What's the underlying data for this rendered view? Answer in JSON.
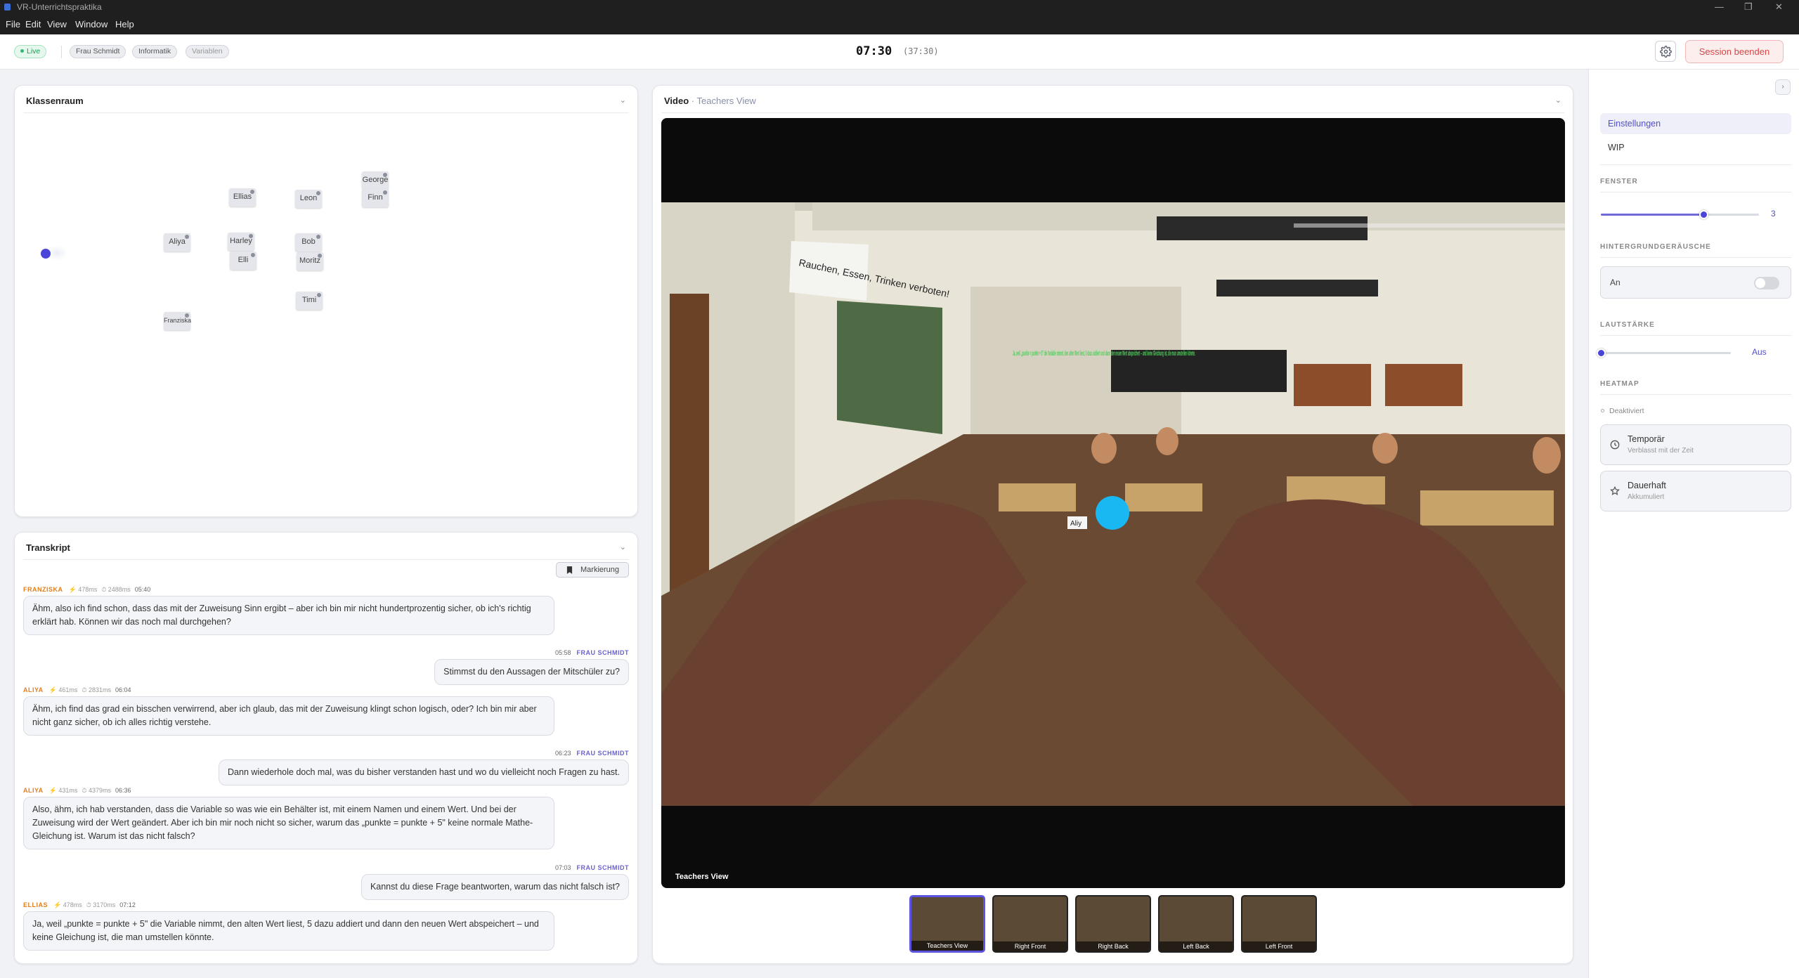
{
  "window": {
    "title": "VR-Unterrichtspraktika"
  },
  "menu": [
    "File",
    "Edit",
    "View",
    "Window",
    "Help"
  ],
  "header": {
    "live_label": "Live",
    "tags": [
      "Frau Schmidt",
      "Informatik",
      "Variablen"
    ],
    "timer": "07:30",
    "timer_total": "(37:30)",
    "end_session_label": "Session beenden"
  },
  "classroom": {
    "title": "Klassenraum",
    "students": [
      "Ellias",
      "Leon",
      "George",
      "Finn",
      "Aliya",
      "Harley",
      "Bob",
      "Elli",
      "Moritz",
      "Timi",
      "Franziska"
    ]
  },
  "transcript": {
    "title": "Transkript",
    "mark_button": "Markierung",
    "messages": [
      {
        "speaker": "FRANZISKA",
        "m1": "⚡ 478ms",
        "m2": "⏱ 2488ms",
        "time": "05:40",
        "text": "Ähm, also ich find schon, dass das mit der Zuweisung Sinn ergibt – aber ich bin mir nicht hundertprozentig sicher, ob ich's richtig erklärt hab. Können wir das noch mal durchgehen?"
      },
      {
        "speaker": "FRAU SCHMIDT",
        "time": "05:58",
        "text": "Stimmst du den Aussagen der Mitschüler zu?"
      },
      {
        "speaker": "ALIYA",
        "m1": "⚡ 461ms",
        "m2": "⏱ 2831ms",
        "time": "06:04",
        "text": "Ähm, ich find das grad ein bisschen verwirrend, aber ich glaub, das mit der Zuweisung klingt schon logisch, oder? Ich bin mir aber nicht ganz sicher, ob ich alles richtig verstehe."
      },
      {
        "speaker": "FRAU SCHMIDT",
        "time": "06:23",
        "text": "Dann wiederhole doch mal, was du bisher verstanden hast und wo du vielleicht noch Fragen zu hast."
      },
      {
        "speaker": "ALIYA",
        "m1": "⚡ 431ms",
        "m2": "⏱ 4379ms",
        "time": "06:36",
        "text": "Also, ähm, ich hab verstanden, dass die Variable so was wie ein Behälter ist, mit einem Namen und einem Wert. Und bei der Zuweisung wird der Wert geändert. Aber ich bin mir noch nicht so sicher, warum das „punkte = punkte + 5\" keine normale Mathe-Gleichung ist. Warum ist das nicht falsch?"
      },
      {
        "speaker": "FRAU SCHMIDT",
        "time": "07:03",
        "text": "Kannst du diese Frage beantworten, warum das nicht falsch ist?"
      },
      {
        "speaker": "ELLIAS",
        "m1": "⚡ 478ms",
        "m2": "⏱ 3170ms",
        "time": "07:12",
        "text": "Ja, weil „punkte = punkte + 5\" die Variable nimmt, den alten Wert liest, 5 dazu addiert und dann den neuen Wert abspeichert – und keine Gleichung ist, die man umstellen könnte."
      }
    ]
  },
  "video": {
    "title": "Video",
    "view": "Teachers View",
    "overlay_label": "Teachers View",
    "board_sign": "Rauchen, Essen, Trinken verboten!",
    "card_label": "Aliy",
    "subtitle": "Ja, weil „punkte = punkte + 5\" die Variable nimmt, den alten Wert liest, 5 dazu addiert und dann den neuen Wert abspeichert – und keine Gleichung ist, die man umstellen könnte.",
    "thumbnails": [
      "Teachers View",
      "Right Front",
      "Right Back",
      "Left Back",
      "Left Front"
    ]
  },
  "sidebar": {
    "tabs": [
      "Einstellungen",
      "WIP"
    ],
    "fenster_label": "FENSTER",
    "fenster_value": "3",
    "fenster_fraction": 0.65,
    "noise_label": "HINTERGRUNDGERÄUSCHE",
    "noise_toggle_label": "An",
    "noise_on": false,
    "volume_label": "LAUTSTÄRKE",
    "volume_value": "Aus",
    "volume_fraction": 0,
    "heatmap_label": "HEATMAP",
    "heatmap_status": "Deaktiviert",
    "heatmap_options": [
      {
        "title": "Temporär",
        "sub": "Verblasst mit der Zeit"
      },
      {
        "title": "Dauerhaft",
        "sub": "Akkumuliert"
      }
    ]
  },
  "colors": {
    "accent": "#5350c4",
    "student_name": "#e07f1f",
    "teacher_name": "#6a60d8",
    "danger": "#d44747",
    "live": "#2dbd6e"
  }
}
